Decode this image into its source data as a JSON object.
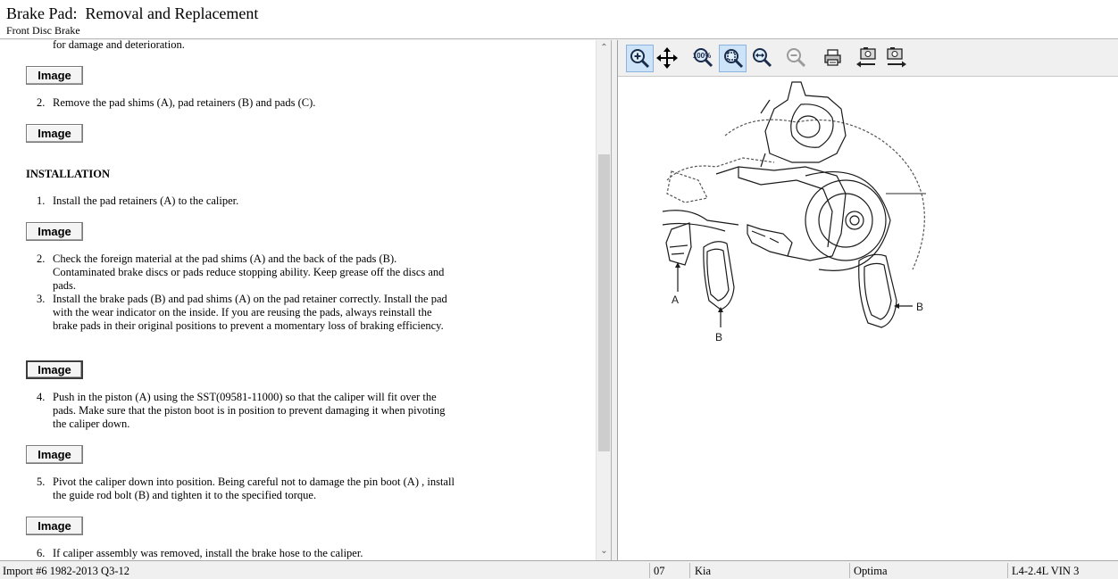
{
  "header": {
    "title": "Brake Pad:  Removal and Replacement",
    "subtitle": "Front Disc Brake"
  },
  "content": {
    "top_cut_text": "for damage and deterioration.",
    "image_button_label": "Image",
    "removal_step2": {
      "number": "2.",
      "text": "Remove the pad shims (A), pad retainers (B) and pads (C)."
    },
    "installation_heading": "INSTALLATION",
    "install_steps": [
      {
        "number": "1.",
        "text": "Install the pad retainers (A) to the caliper."
      },
      {
        "number": "2.",
        "text": "Check the foreign material at the pad shims (A) and the back of the pads (B). Contaminated brake discs or pads reduce stopping ability. Keep grease off the discs and pads."
      },
      {
        "number": "3.",
        "text": "Install the brake pads (B) and pad shims (A) on the pad retainer correctly. Install the pad with the wear indicator on the inside. If you are reusing the pads, always reinstall the brake pads in their original positions to prevent a momentary loss of braking efficiency."
      },
      {
        "number": "4.",
        "text": "Push in the piston (A) using the SST(09581-11000) so that the caliper will fit over the pads. Make sure that the piston boot is in position to prevent damaging it when pivoting the caliper down."
      },
      {
        "number": "5.",
        "text": "Pivot the caliper down into position. Being careful not to damage the pin boot (A) , install the guide rod bolt (B) and tighten it to the specified torque."
      },
      {
        "number": "6.",
        "text": "If caliper assembly was removed, install the brake hose to the caliper."
      }
    ]
  },
  "scrollbar": {
    "up_arrow": "⌃",
    "down_arrow": "⌄"
  },
  "toolbar": {
    "tools": [
      "zoom-in-tool",
      "pan-tool",
      "actual-size-tool",
      "fit-window-tool",
      "fit-width-tool",
      "zoom-out-tool",
      "print-tool",
      "previous-image-tool",
      "next-image-tool"
    ],
    "actual_size_label": "100%"
  },
  "diagram": {
    "labels": [
      "A",
      "B",
      "B"
    ]
  },
  "status_bar": {
    "source": "Import #6 1982-2013 Q3-12",
    "year": "07",
    "make": "Kia",
    "model": "Optima",
    "engine": "L4-2.4L VIN 3"
  }
}
